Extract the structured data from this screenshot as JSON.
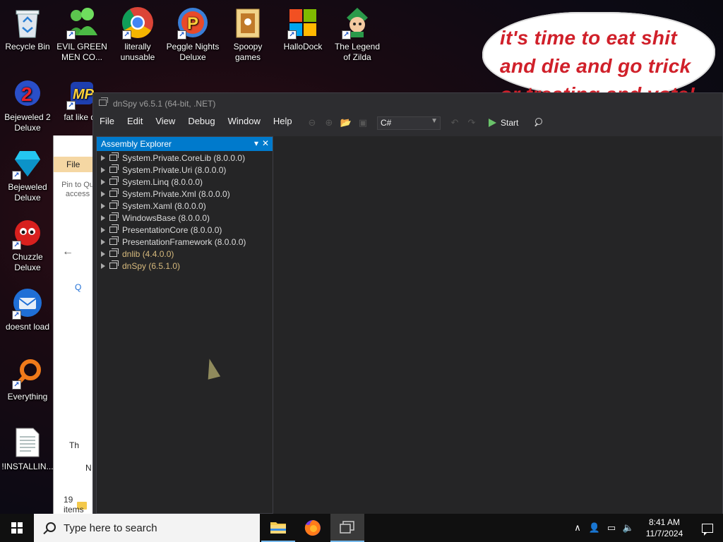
{
  "desktop": {
    "icons": [
      {
        "label": "Recycle Bin",
        "icon": "recycle-bin-icon"
      },
      {
        "label": "EVIL GREEN MEN CO...",
        "icon": "messenger-icon"
      },
      {
        "label": "literally unusable",
        "icon": "chrome-icon"
      },
      {
        "label": "Peggle Nights Deluxe",
        "icon": "peggle-icon"
      },
      {
        "label": "Spoopy games",
        "icon": "folder-icon"
      },
      {
        "label": "HalloDock",
        "icon": "windows-logo-icon"
      },
      {
        "label": "The Legend of Zilda",
        "icon": "zelda-icon"
      },
      {
        "label": "Bejeweled 2 Deluxe",
        "icon": "bejeweled2-icon"
      },
      {
        "label": "fat like da",
        "icon": "mp-icon"
      },
      {
        "label": "Bejeweled Deluxe",
        "icon": "gem-icon"
      },
      {
        "label": "Chuzzle Deluxe",
        "icon": "chuzzle-icon"
      },
      {
        "label": "doesnt load",
        "icon": "thunderbird-icon"
      },
      {
        "label": "Everything",
        "icon": "everything-search-icon"
      },
      {
        "label": "!INSTALLIN...",
        "icon": "text-document-icon"
      }
    ],
    "bubble_text": "it's time to eat shit and die and go trick or treating and vote!"
  },
  "explorer": {
    "file_tab": "File",
    "pin_label": "Pin to Qu access",
    "nav_quick": "Q",
    "this_pc": "Th",
    "network": "N",
    "status": "19 items"
  },
  "dnspy": {
    "title": "dnSpy v6.5.1 (64-bit, .NET)",
    "menu": [
      "File",
      "Edit",
      "View",
      "Debug",
      "Window",
      "Help"
    ],
    "language": "C#",
    "start_label": "Start",
    "pane_title": "Assembly Explorer",
    "assemblies": [
      {
        "name": "System.Private.CoreLib (8.0.0.0)",
        "highlight": false
      },
      {
        "name": "System.Private.Uri (8.0.0.0)",
        "highlight": false
      },
      {
        "name": "System.Linq (8.0.0.0)",
        "highlight": false
      },
      {
        "name": "System.Private.Xml (8.0.0.0)",
        "highlight": false
      },
      {
        "name": "System.Xaml (8.0.0.0)",
        "highlight": false
      },
      {
        "name": "WindowsBase (8.0.0.0)",
        "highlight": false
      },
      {
        "name": "PresentationCore (8.0.0.0)",
        "highlight": false
      },
      {
        "name": "PresentationFramework (8.0.0.0)",
        "highlight": false
      },
      {
        "name": "dnlib (4.4.0.0)",
        "highlight": true
      },
      {
        "name": "dnSpy (6.5.1.0)",
        "highlight": true
      }
    ]
  },
  "taskbar": {
    "search_placeholder": "Type here to search",
    "time": "8:41 AM",
    "date": "11/7/2024"
  },
  "colors": {
    "accent": "#007acc",
    "bubble_text": "#d0202a",
    "highlight_asm": "#d7ba7d"
  }
}
